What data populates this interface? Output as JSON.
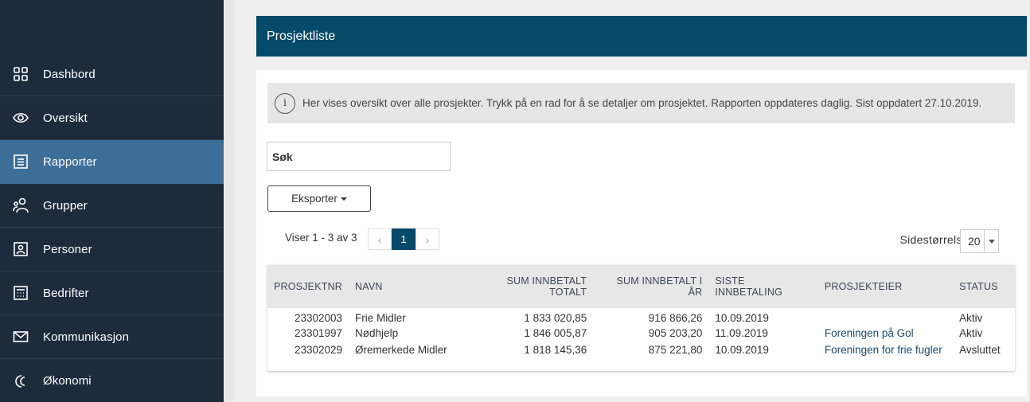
{
  "sidebar": {
    "items": [
      {
        "label": "Dashbord",
        "icon": "dashboard-grid-icon"
      },
      {
        "label": "Oversikt",
        "icon": "eye-icon"
      },
      {
        "label": "Rapporter",
        "icon": "report-icon",
        "active": true
      },
      {
        "label": "Grupper",
        "icon": "group-icon"
      },
      {
        "label": "Personer",
        "icon": "person-card-icon"
      },
      {
        "label": "Bedrifter",
        "icon": "building-icon"
      },
      {
        "label": "Kommunikasjon",
        "icon": "envelope-icon"
      },
      {
        "label": "Økonomi",
        "icon": "economy-icon"
      }
    ]
  },
  "header": {
    "title": "Prosjektliste"
  },
  "info": {
    "icon": "i",
    "text": "Her vises oversikt over alle prosjekter. Trykk på en rad for å se detaljer om prosjektet. Rapporten oppdateres daglig. Sist oppdatert 27.10.2019."
  },
  "search": {
    "placeholder": "Søk"
  },
  "export": {
    "label": "Eksporter"
  },
  "pagination": {
    "summary": "Viser 1 - 3 av 3",
    "prev": "‹",
    "current": "1",
    "next": "›"
  },
  "page_size": {
    "label": "Sidestørrelse:",
    "value": "20"
  },
  "table": {
    "headers": [
      "PROSJEKTNR",
      "NAVN",
      "SUM INNBETALT TOTALT",
      "SUM INNBETALT I ÅR",
      "SISTE INNBETALING",
      "PROSJEKTEIER",
      "STATUS"
    ],
    "rows": [
      [
        "23302003",
        "Frie Midler",
        "1 833 020,85",
        "916 866,26",
        "10.09.2019",
        "",
        "Aktiv"
      ],
      [
        "23301997",
        "Nødhjelp",
        "1 846 005,87",
        "905 203,20",
        "11.09.2019",
        "Foreningen på Gol",
        "Aktiv"
      ],
      [
        "23302029",
        "Øremerkede Midler",
        "1 818 145,36",
        "875 221,80",
        "10.09.2019",
        "Foreningen for frie fugler",
        "Avsluttet"
      ]
    ]
  },
  "colors": {
    "sidebar_bg": "#1d2b3d",
    "sidebar_active": "#3d6e98",
    "header_bg": "#054a68",
    "link": "#1e4a6e"
  }
}
